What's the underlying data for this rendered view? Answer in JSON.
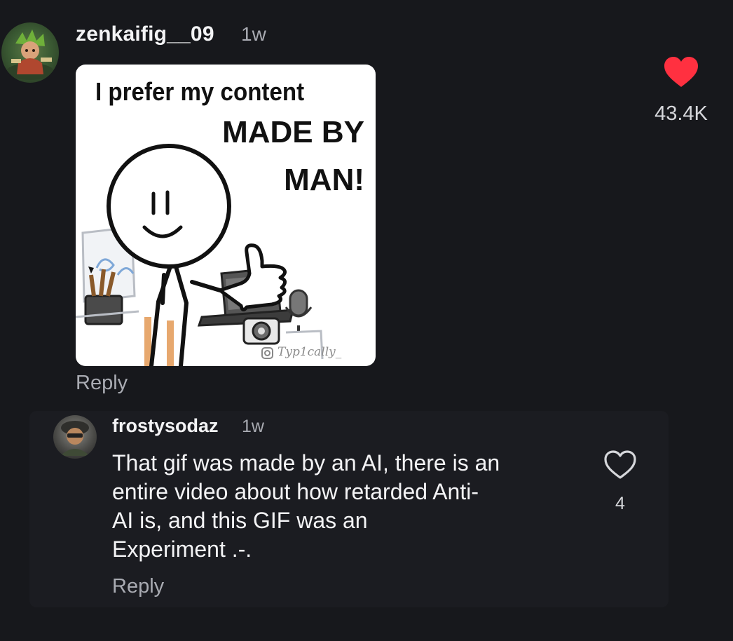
{
  "main_comment": {
    "username": "zenkaifig__09",
    "time": "1w",
    "meme_image": {
      "line1": "I prefer my content",
      "line2": "MADE BY",
      "line3": "MAN!",
      "watermark": "Typ1cally_"
    },
    "reply_label": "Reply",
    "like": {
      "icon": "heart-filled-icon",
      "count": "43.4K",
      "color": "#ff3040",
      "liked": true
    }
  },
  "reply_comment": {
    "username": "frostysodaz",
    "time": "1w",
    "text_lines": [
      "That gif was made by an AI, there is an",
      "entire video about how retarded Anti-",
      "AI is, and this GIF was an",
      "Experiment .-."
    ],
    "reply_label": "Reply",
    "like": {
      "icon": "heart-outline-icon",
      "count": "4",
      "liked": false
    }
  },
  "colors": {
    "background": "#17181c",
    "reply_card": "#1b1c21",
    "primary_text": "#f3f3f5",
    "secondary_text": "#a9abb2",
    "like_red": "#ff3040"
  }
}
